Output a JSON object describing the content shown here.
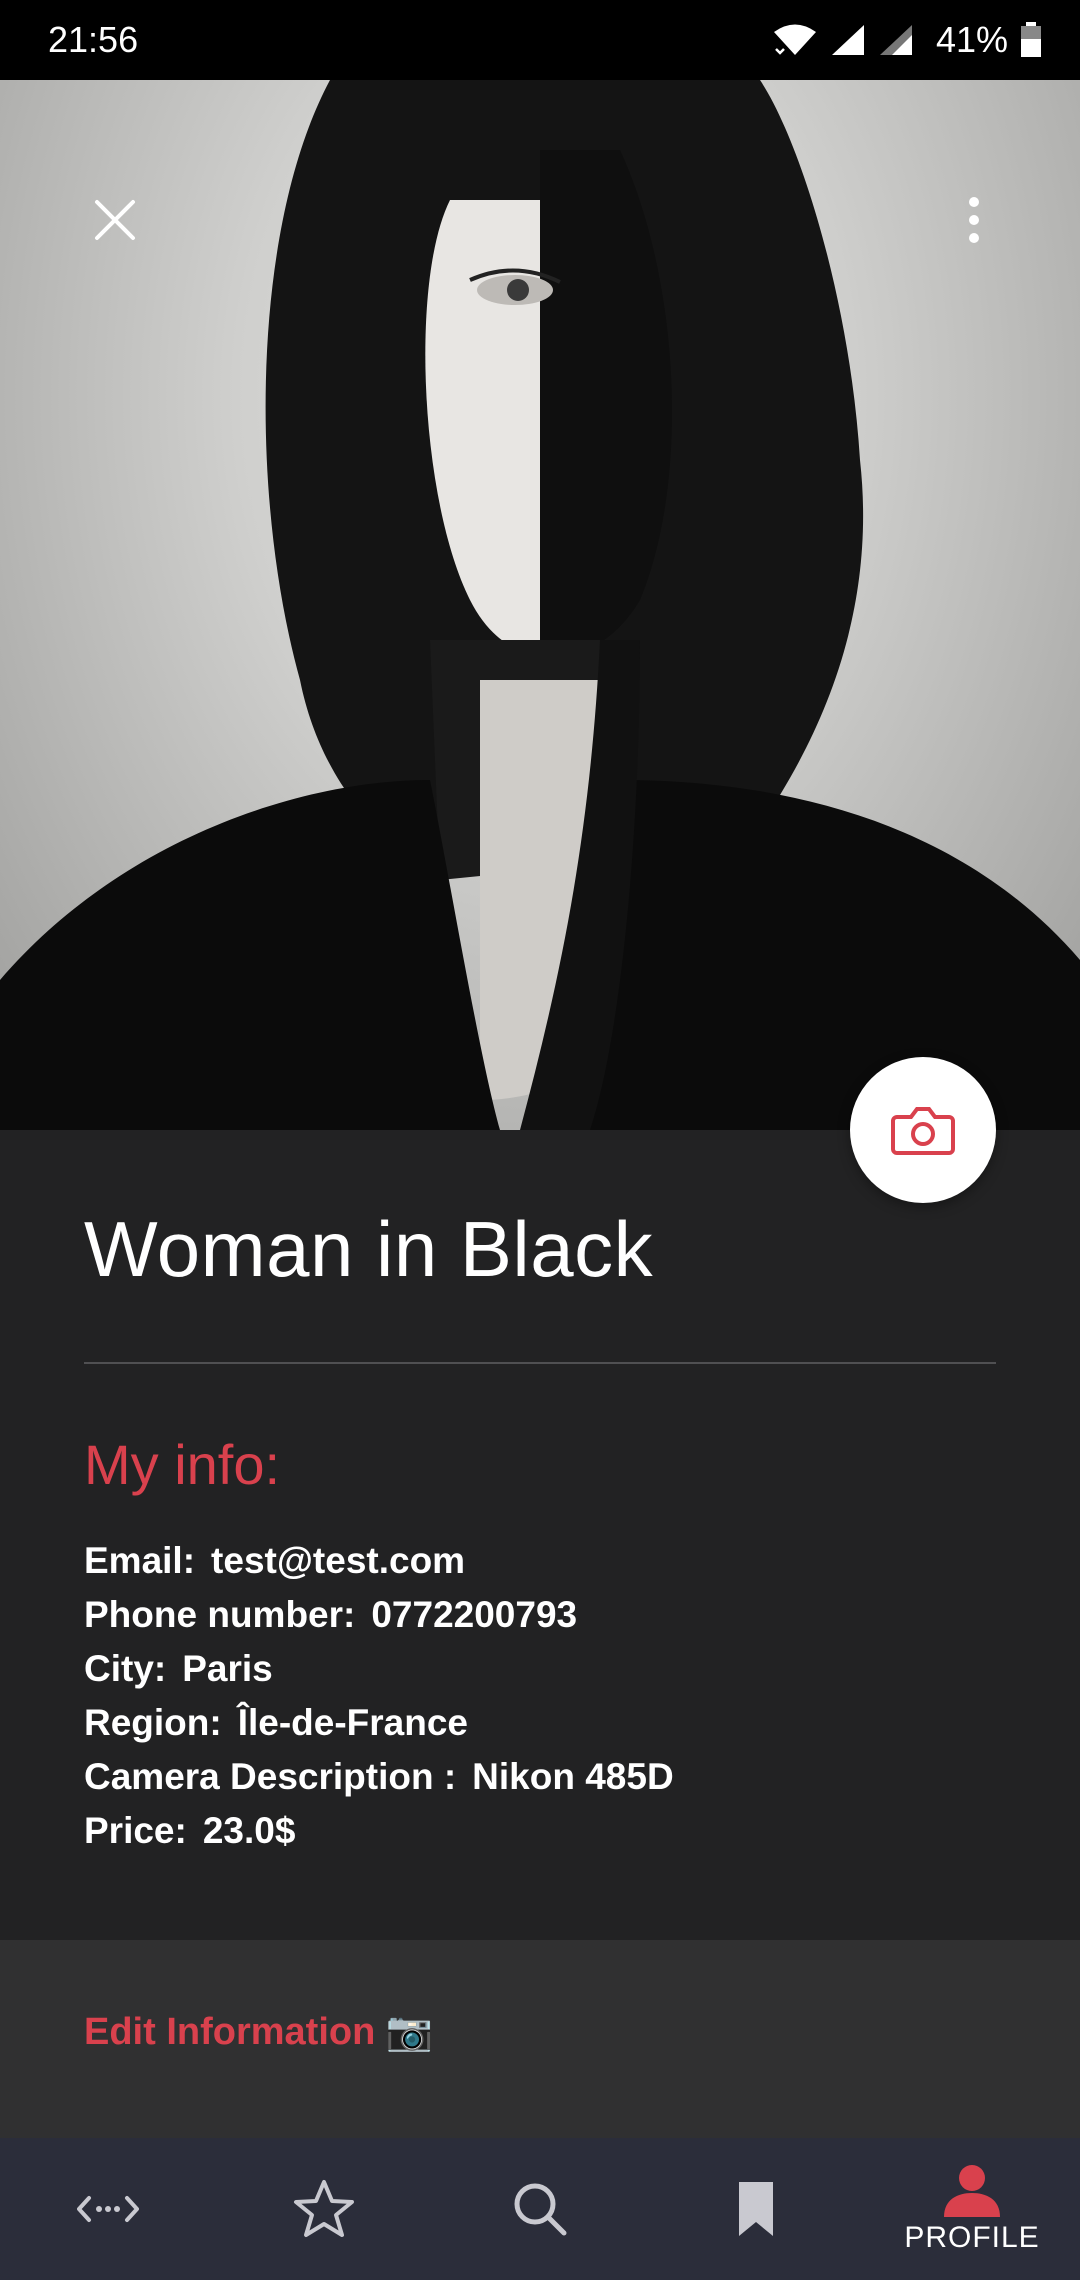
{
  "status_bar": {
    "time": "21:56",
    "battery": "41%"
  },
  "hero": {
    "image_desc": "black-and-white portrait photo"
  },
  "profile": {
    "name": "Woman in Black"
  },
  "info": {
    "heading": "My info:",
    "rows": [
      {
        "label": "Email:",
        "value": "test@test.com"
      },
      {
        "label": "Phone number:",
        "value": "0772200793"
      },
      {
        "label": "City:",
        "value": "Paris"
      },
      {
        "label": "Region:",
        "value": "Île-de-France"
      },
      {
        "label": "Camera Description :",
        "value": "Nikon 485D"
      },
      {
        "label": "Price:",
        "value": "23.0$"
      }
    ]
  },
  "edit": {
    "label": "Edit Information 📷"
  },
  "bottom_nav": {
    "active_label": "PROFILE",
    "items": [
      "swap",
      "favorites",
      "search",
      "bookmarks",
      "profile"
    ]
  },
  "colors": {
    "accent": "#d9414d",
    "background": "#222223",
    "nav": "#2b2d3a"
  }
}
